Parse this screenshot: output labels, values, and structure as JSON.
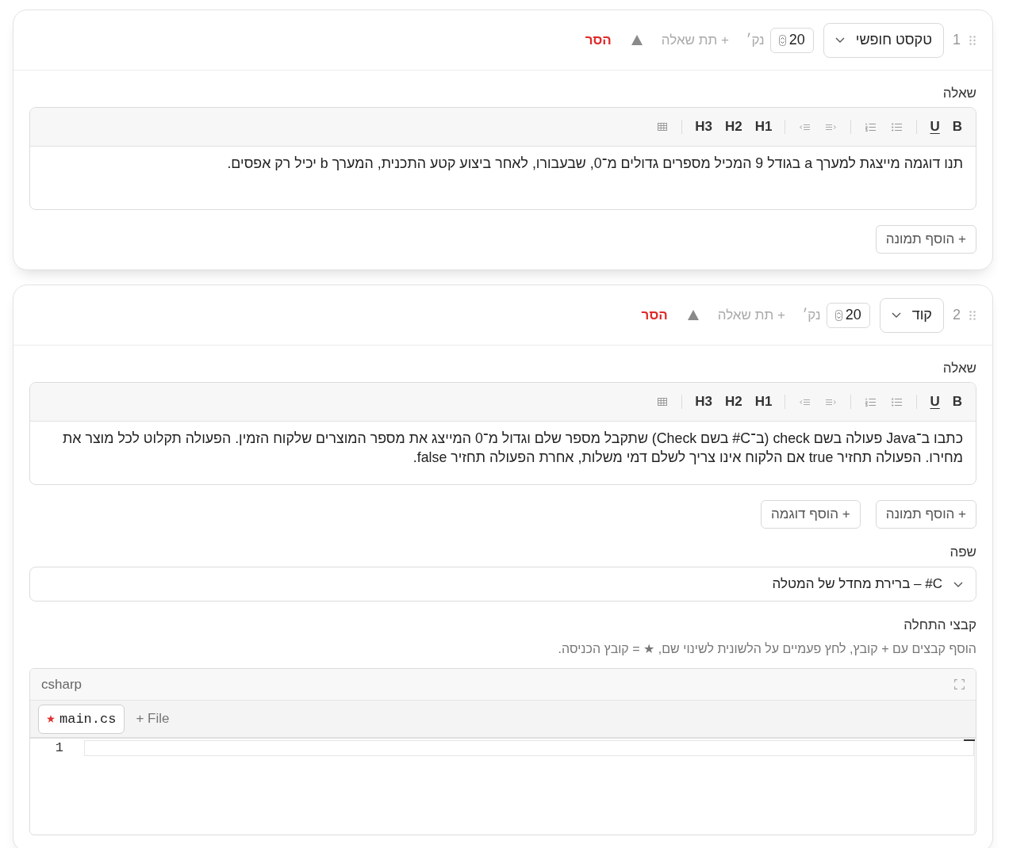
{
  "questions": [
    {
      "number": "1",
      "type": "טקסט חופשי",
      "points": "20",
      "points_label": "נק׳",
      "add_subquestion": "+ תת שאלה",
      "remove": "הסר",
      "question_label": "שאלה",
      "toolbar": [
        [
          {
            "kind": "bold",
            "label": "B"
          },
          {
            "kind": "underline",
            "label": "U"
          }
        ],
        [
          {
            "kind": "bullet-list"
          },
          {
            "kind": "numbered-list"
          }
        ],
        [
          {
            "kind": "indent"
          },
          {
            "kind": "outdent"
          }
        ],
        [
          {
            "kind": "heading",
            "label": "H1"
          },
          {
            "kind": "heading",
            "label": "H2"
          },
          {
            "kind": "heading",
            "label": "H3"
          }
        ],
        [
          {
            "kind": "table"
          }
        ]
      ],
      "text": "תנו דוגמה מייצגת למערך a בגודל 9 המכיל מספרים גדולים מ־0, שבעבורו, לאחר ביצוע קטע התכנית, המערך b יכיל רק אפסים.",
      "buttons": [
        "+ הוסף תמונה"
      ]
    },
    {
      "number": "2",
      "type": "קוד",
      "points": "20",
      "points_label": "נק׳",
      "add_subquestion": "+ תת שאלה",
      "remove": "הסר",
      "question_label": "שאלה",
      "toolbar": [
        [
          {
            "kind": "bold",
            "label": "B"
          },
          {
            "kind": "underline",
            "label": "U"
          }
        ],
        [
          {
            "kind": "bullet-list"
          },
          {
            "kind": "numbered-list"
          }
        ],
        [
          {
            "kind": "indent"
          },
          {
            "kind": "outdent"
          }
        ],
        [
          {
            "kind": "heading",
            "label": "H1"
          },
          {
            "kind": "heading",
            "label": "H2"
          },
          {
            "kind": "heading",
            "label": "H3"
          }
        ],
        [
          {
            "kind": "table"
          }
        ]
      ],
      "text": "כתבו ב־Java פעולה בשם check (ב־C# בשם Check) שתקבל מספר שלם וגדול מ־0 המייצג את מספר המוצרים שלקוח הזמין. הפעולה תקלוט לכל מוצר את מחירו. הפעולה תחזיר true אם הלקוח אינו צריך לשלם דמי משלות, אחרת הפעולה תחזיר false.",
      "buttons": [
        "+ הוסף תמונה",
        "+ הוסף דוגמה"
      ],
      "language": {
        "label": "שפה",
        "value": "C# – ברירת מחדל של המטלה"
      },
      "starter_files": {
        "label": "קבצי התחלה",
        "hint": "הוסף קבצים עם + קובץ, לחץ פעמיים על הלשונית לשינוי שם, ★ = קובץ הכניסה.",
        "editor": {
          "language": "csharp",
          "tabs": [
            {
              "name": "main.cs",
              "entry": true,
              "selected": true
            }
          ],
          "add_file": "+ File",
          "lines": [
            "1"
          ]
        }
      }
    }
  ]
}
